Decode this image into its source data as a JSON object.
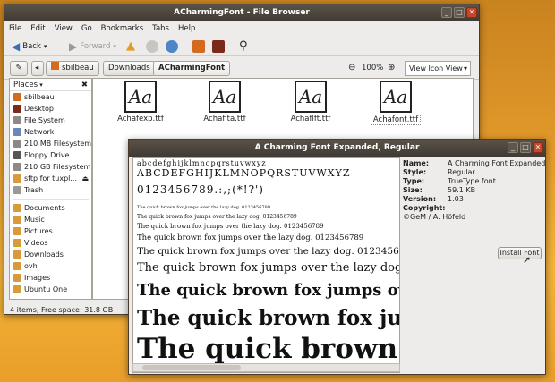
{
  "fb": {
    "title": "ACharmingFont - File Browser",
    "menu": [
      "File",
      "Edit",
      "View",
      "Go",
      "Bookmarks",
      "Tabs",
      "Help"
    ],
    "toolbar": {
      "back": "Back",
      "forward": "Forward"
    },
    "crumbs": [
      "sbilbeau",
      "Downloads",
      "ACharmingFont"
    ],
    "zoom": "100%",
    "view_mode": "View Icon View",
    "places_label": "Places",
    "places": [
      "sbilbeau",
      "Desktop",
      "File System",
      "Network",
      "210 MB Filesystem",
      "Floppy Drive",
      "210 GB Filesystem",
      "sftp for tuxpl...",
      "Trash"
    ],
    "bookmarks": [
      "Documents",
      "Music",
      "Pictures",
      "Videos",
      "Downloads",
      "ovh",
      "Images",
      "Ubuntu One"
    ],
    "files": [
      "Achafexp.ttf",
      "Achafita.ttf",
      "Achaflft.ttf",
      "Achafont.ttf"
    ],
    "file_glyph": "Aa",
    "status": "4 items, Free space: 31.8 GB"
  },
  "fv": {
    "title": "A Charming Font Expanded, Regular",
    "sample_lower": "abcdefghijklmnopqrstuvwxyz",
    "sample_upper": "ABCDEFGHIJKLMNOPQRSTUVWXYZ",
    "sample_digits": "0123456789.:,;(*!?')",
    "sample_sentence": "The quick brown fox jumps over the lazy dog. 0123456789",
    "info": [
      [
        "Name:",
        "A Charming Font Expanded"
      ],
      [
        "Style:",
        "Regular"
      ],
      [
        "Type:",
        "TrueType font"
      ],
      [
        "Size:",
        "59.1 KB"
      ],
      [
        "Version:",
        "1.03"
      ],
      [
        "Copyright:",
        ""
      ],
      [
        "",
        "©GeM / A. Höfeld"
      ]
    ],
    "install": "Install Font"
  }
}
